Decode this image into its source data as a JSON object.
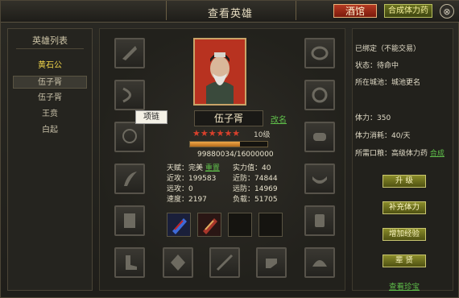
{
  "window": {
    "title": "查看英雄",
    "tavern_label": "酒馆",
    "potion_label": "合成体力药",
    "close_glyph": "⊗"
  },
  "hero_list": {
    "title": "英雄列表",
    "items": [
      {
        "label": "黄石公",
        "state": "gold"
      },
      {
        "label": "伍子胥",
        "state": "selected"
      },
      {
        "label": "伍子胥",
        "state": "normal"
      },
      {
        "label": "王贲",
        "state": "normal"
      },
      {
        "label": "白起",
        "state": "normal"
      }
    ]
  },
  "hero": {
    "name": "伍子胥",
    "rename_label": "改名",
    "stars": "★★★★★★",
    "level": "10级",
    "exp_text": "99880034/16000000",
    "exp_fraction": 0.65,
    "tooltip": "项链",
    "stats": {
      "talent_label": "天赋：完美",
      "reset_label": "重置",
      "power_label": "实力值：40",
      "melee_atk": "近攻：199583",
      "melee_def": "近防：74844",
      "ranged_atk": "远攻：0",
      "ranged_def": "远防：14969",
      "speed": "速度：2197",
      "load": "负载：51705"
    }
  },
  "info": {
    "bound": "已绑定（不能交易）",
    "status": "状态：待命中",
    "city_label": "所在城池：城池更名",
    "stamina": "体力：350",
    "stamina_cost": "体力消耗：40/天",
    "ration_label": "所需口粮：高级体力药",
    "synth_link": "合成"
  },
  "actions": {
    "upgrade": "升 级",
    "replenish": "补充体力",
    "add_exp": "增加经验",
    "dismiss": "辈 贤",
    "view_treasure": "查看珍宝"
  },
  "colors": {
    "link": "#5fbf4a",
    "gold_item": "#f2d64a",
    "tavern": "#b53a22",
    "button": "#8a8c2a"
  }
}
